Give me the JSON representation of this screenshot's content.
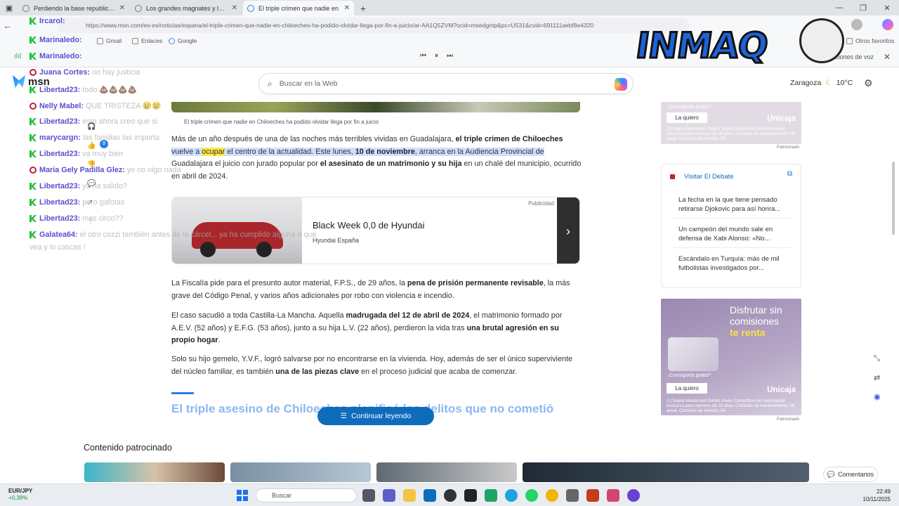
{
  "browser": {
    "tabs": [
      {
        "title": "Perdiendo la base republicana, la"
      },
      {
        "title": "Los grandes magnates y los hom"
      },
      {
        "title": "El triple crimen que nadie en"
      }
    ],
    "url": "https://www.msn.com/es-es/noticias/espana/el-triple-crimen-que-nadie-en-chiloeches-ha-podido-olvidar-llega-por-fin-a-juicio/ar-AA1Q5ZVM?ocid=msedgntp&pc=U531&cvid=691111aebf8e4320",
    "bookmarks": [
      "Gmail",
      "Enlaces",
      "Google"
    ],
    "other_favorites": "Otros favoritos",
    "read_aloud_voice": "Opciones de voz"
  },
  "msn": {
    "logo": "msn",
    "search_placeholder": "Buscar en la Web",
    "location": "Zaragoza",
    "temperature": "10°C"
  },
  "article": {
    "caption": "El triple crimen que nadie en Chiloeches ha podido olvidar llega por fin a juicio",
    "p1": {
      "a": "Más de un año después de una de las noches más terribles vividas en Guadalajara, ",
      "b": "el triple crimen de Chiloeches",
      "c": " vuelve a ",
      "d": "ocupar",
      "e": " el centro de la actualidad. Este lunes, ",
      "f": "10 de noviembre",
      "g": ", arranca en la Audiencia Provincial de",
      "h": " Guadalajara el juicio con jurado popular por ",
      "i": "el asesinato de un matrimonio y su hija",
      "j": " en un chalé del municipio, ocurrido en abril de 2024."
    },
    "ad": {
      "label": "Publicidad",
      "headline": "Black Week 0,0 de Hyundai",
      "advertiser": "Hyundai España"
    },
    "p2": {
      "a": "La Fiscalía pide para el presunto autor material, F.P.S., de 29 años, la ",
      "b": "pena de prisión permanente revisable",
      "c": ", la más grave del Código Penal, y varios años adicionales por robo con violencia e incendio."
    },
    "p3": {
      "a": "El caso sacudió a toda Castilla-La Mancha. Aquella ",
      "b": "madrugada del 12 de abril de 2024",
      "c": ", el matrimonio formado por A.E.V. (52 años) y E.F.G. (53 años), junto a su hija L.V. (22 años), perdieron la vida tras ",
      "d": "una brutal agresión en su propio hogar",
      "e": "."
    },
    "p4": {
      "a": "Solo su hijo gemelo, Y.V.F., logró salvarse por no encontrarse en la vivienda. Hoy, además de ser el único superviviente del núcleo familiar, es también ",
      "b": "una de las piezas clave",
      "c": " en el proceso judicial que acaba de comenzar."
    },
    "subheading": "El triple asesino de Chiloeches planificó los delitos que no cometió",
    "continue_label": "Continuar leyendo",
    "sponsored_title": "Contenido patrocinado",
    "comments_label": "Comentarios"
  },
  "sidebar": {
    "ad_top": {
      "grat": "¡Consíguela gratis!*",
      "button": "La quiero",
      "brand": "Unicaja",
      "legal": "(1)Tarjeta Mastercard Débito Joven Contactless de contratación exclusiva para menores de 28 años. Comisión de mantenimiento: 0€ anual. Comisión de emisión: 0€.",
      "sponsored": "Patrocinado"
    },
    "debate": {
      "header": "Visitar El Debate",
      "items": [
        "La fecha en la que tiene pensado retirarse Djokovic para así honra...",
        "Un campeón del mundo sale en defensa de Xabi Alonso: «No...",
        "Escándalo en Turquía: más de mil futbolistas investigados por..."
      ]
    },
    "ad_big": {
      "line1": "Disfrutar sin comisiones",
      "line2": "te renta",
      "grat": "¡Consíguela gratis!*",
      "button": "La quiero",
      "brand": "Unicaja",
      "legal": "(1)Tarjeta Mastercard Débito Joven Contactless de contratación exclusiva para menores de 28 años. Comisión de mantenimiento: 0€ anual. Comisión de emisión: 0€.",
      "sponsored": "Patrocinado"
    }
  },
  "chat": {
    "messages": [
      {
        "user": "Ircarol:",
        "text": "",
        "badge": "k"
      },
      {
        "user": "Marinaledo:",
        "text": "",
        "badge": "k"
      },
      {
        "user": "Marinaledo:",
        "text": "",
        "badge": "k"
      },
      {
        "user": "Juana Cortes:",
        "text": "no hay justicia",
        "badge": "r"
      },
      {
        "user": "Libertad23:",
        "text": "todo 💩💩💩💩",
        "badge": "k"
      },
      {
        "user": "Nelly Mabel:",
        "text": "QUE TRISTEZA 😢😢",
        "badge": "r"
      },
      {
        "user": "Libertad23:",
        "text": "esto ahora creo que sí",
        "badge": "k"
      },
      {
        "user": "marycargn:",
        "text": "las familias las importa",
        "badge": "k"
      },
      {
        "user": "Libertad23:",
        "text": "va muy bien",
        "badge": "k"
      },
      {
        "user": "Maria Gely Padilla Glez:",
        "text": "yo no oigo nada",
        "badge": "r"
      },
      {
        "user": "Libertad23:",
        "text": "ya ha salido?",
        "badge": "k"
      },
      {
        "user": "Libertad23:",
        "text": "pero gafotas",
        "badge": "k"
      },
      {
        "user": "Libertad23:",
        "text": "mas circo??",
        "badge": "k"
      },
      {
        "user": "Galatea64:",
        "text": "el otro cozzi también antes de la cárcel... ya ha cumplido alguna o que",
        "badge": "k"
      }
    ],
    "continuation": "vea y lo cascas !",
    "reaction_count": "9"
  },
  "overlay": {
    "logo_text": "INMAQ"
  },
  "taskbar": {
    "ticker": "EUR/JPY",
    "change": "+0,39%",
    "search": "Buscar",
    "time": "22:49",
    "date": "10/11/2025"
  }
}
